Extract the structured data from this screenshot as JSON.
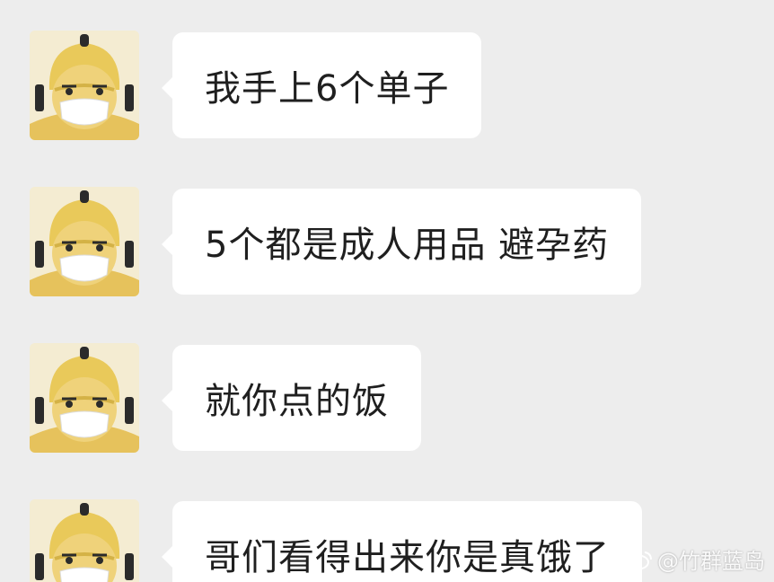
{
  "messages": [
    {
      "sender": "courier",
      "avatar_icon": "masked-courier-avatar-icon",
      "text": "我手上6个单子"
    },
    {
      "sender": "courier",
      "avatar_icon": "masked-courier-avatar-icon",
      "text": "5个都是成人用品 避孕药"
    },
    {
      "sender": "courier",
      "avatar_icon": "masked-courier-avatar-icon",
      "text": "就你点的饭"
    },
    {
      "sender": "courier",
      "avatar_icon": "masked-courier-avatar-icon",
      "text": "哥们看得出来你是真饿了"
    }
  ],
  "watermark": {
    "icon": "weibo-icon",
    "handle": "@竹群蓝岛"
  },
  "colors": {
    "background": "#ededed",
    "bubble": "#ffffff",
    "text": "#1f1f1f",
    "avatar_bg": "#f4ecd2",
    "helmet": "#e9c95a"
  }
}
